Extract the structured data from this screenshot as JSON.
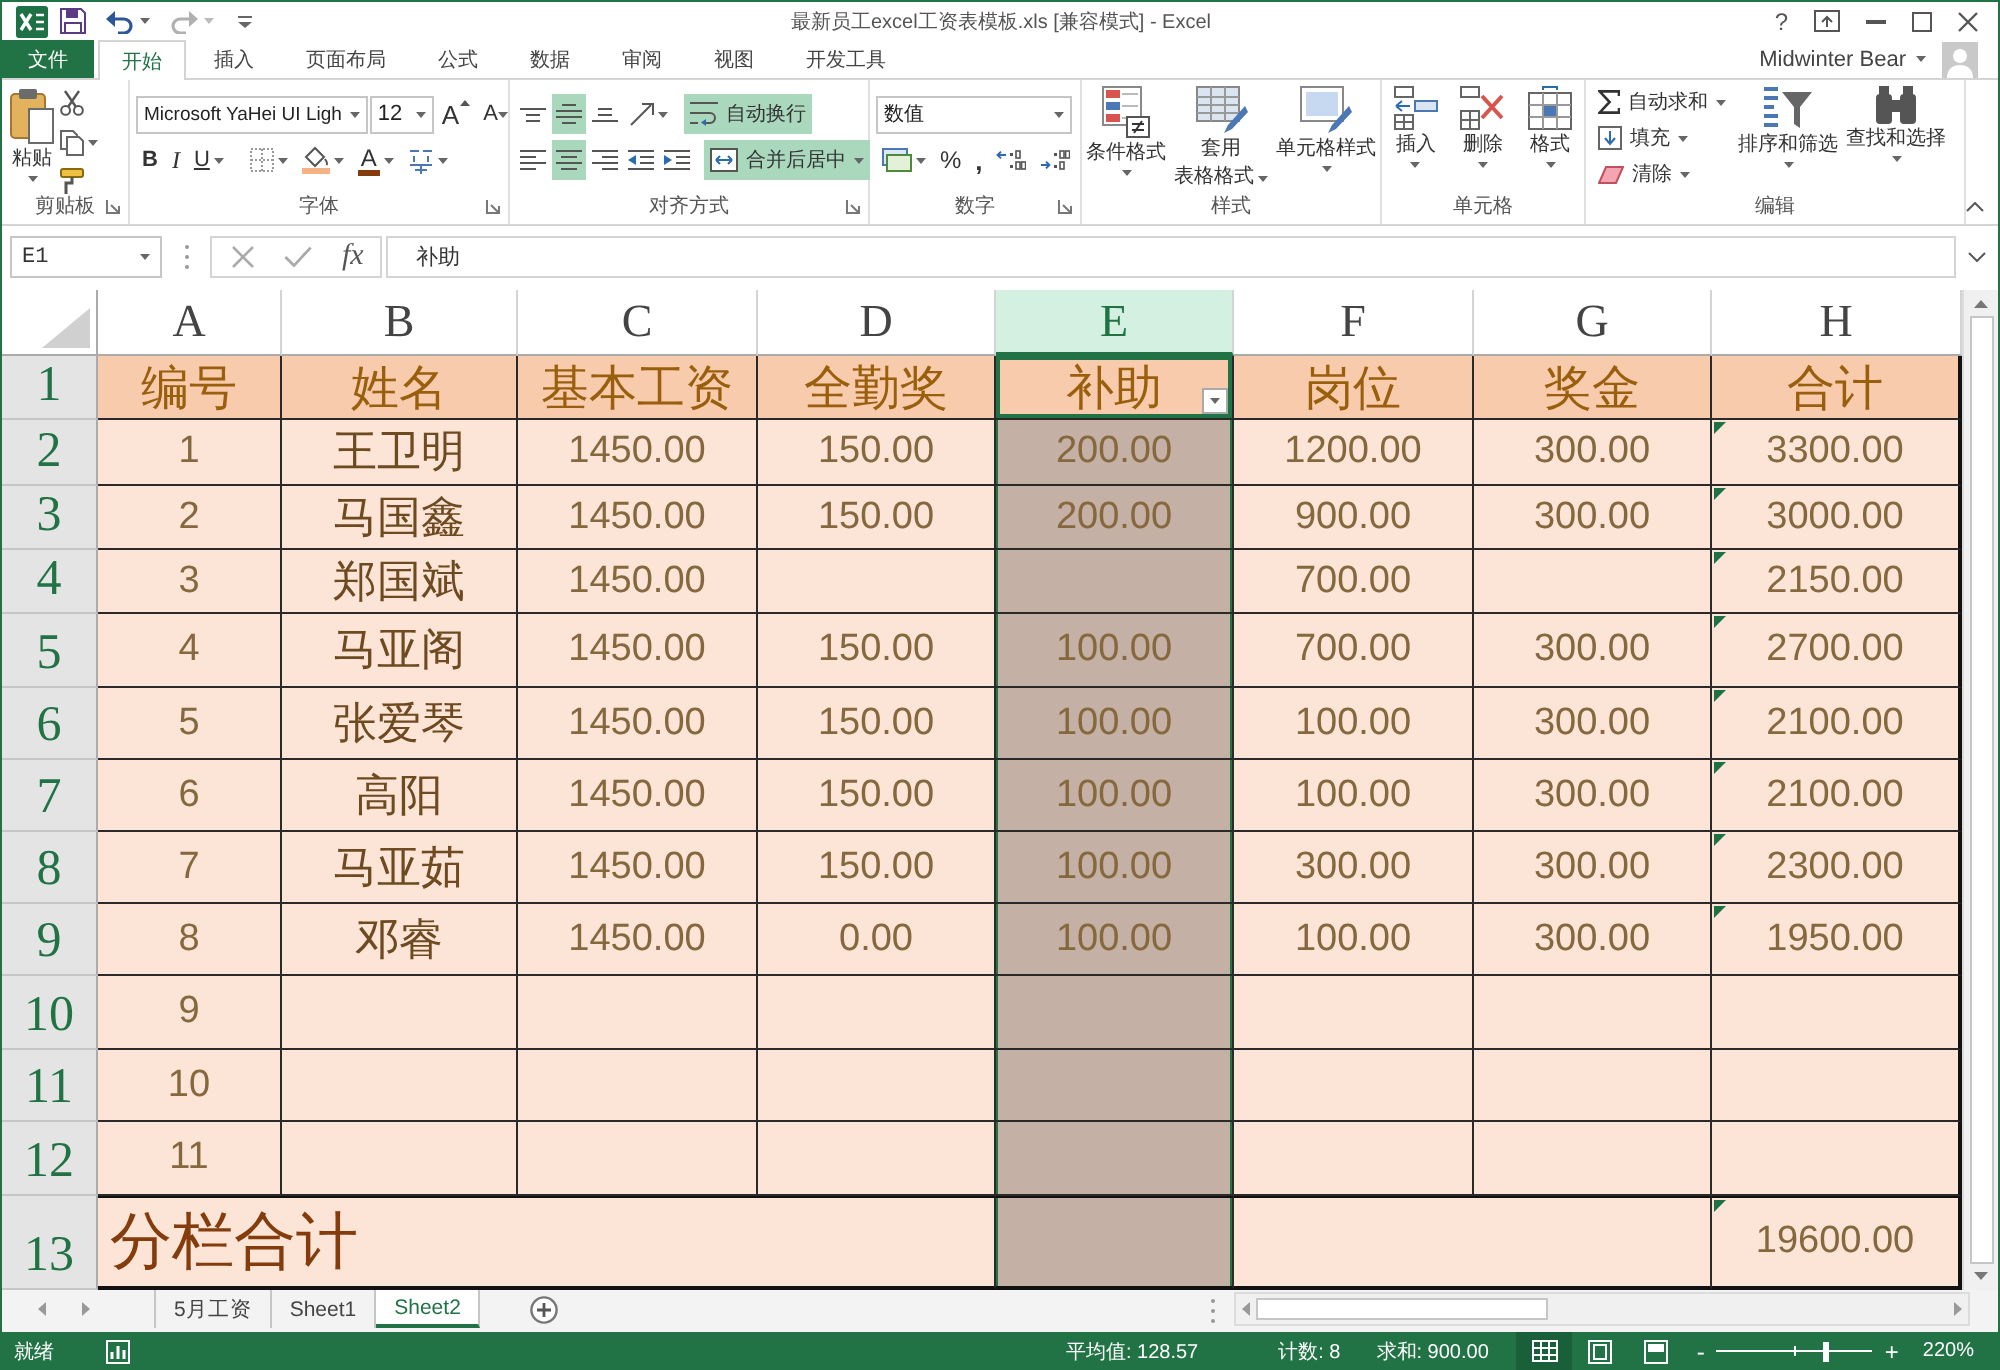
{
  "window": {
    "title": "最新员工excel工资表模板.xls [兼容模式] - Excel",
    "help": "?",
    "user": "Midwinter Bear"
  },
  "ribbon_tabs": [
    {
      "label": "文件",
      "kind": "file",
      "selected": false
    },
    {
      "label": "开始",
      "kind": "tab",
      "selected": true
    },
    {
      "label": "插入",
      "kind": "tab",
      "selected": false
    },
    {
      "label": "页面布局",
      "kind": "tab",
      "selected": false
    },
    {
      "label": "公式",
      "kind": "tab",
      "selected": false
    },
    {
      "label": "数据",
      "kind": "tab",
      "selected": false
    },
    {
      "label": "审阅",
      "kind": "tab",
      "selected": false
    },
    {
      "label": "视图",
      "kind": "tab",
      "selected": false
    },
    {
      "label": "开发工具",
      "kind": "tab",
      "selected": false
    }
  ],
  "ribbon": {
    "groups": [
      {
        "kind": "clipboard",
        "label": "剪贴板",
        "launcher": true,
        "paste": "粘贴"
      },
      {
        "kind": "font",
        "label": "字体",
        "launcher": true,
        "font_name": "Microsoft YaHei UI Ligh",
        "font_size": "12",
        "grow": "A",
        "shrink": "A",
        "bold": "B",
        "italic": "I",
        "underline": "U",
        "font_color": "A"
      },
      {
        "kind": "alignment",
        "label": "对齐方式",
        "launcher": true,
        "vertical_align": [
          {
            "kind": "top",
            "selected": false
          },
          {
            "kind": "middle",
            "selected": true
          },
          {
            "kind": "bottom",
            "selected": false
          }
        ],
        "horizontal_align": [
          {
            "kind": "left",
            "selected": false
          },
          {
            "kind": "center",
            "selected": true
          },
          {
            "kind": "right",
            "selected": false
          }
        ],
        "wrap_text": {
          "label": "自动换行",
          "on": true
        },
        "merge": {
          "label": "合并后居中",
          "on": true
        }
      },
      {
        "kind": "number",
        "label": "数字",
        "launcher": true,
        "format": "数值",
        "percent": "%",
        "comma": ","
      },
      {
        "kind": "styles",
        "label": "样式",
        "launcher": false,
        "buttons": [
          {
            "kind": "conditional",
            "lines": [
              "条件格式"
            ]
          },
          {
            "kind": "table",
            "lines": [
              "套用",
              "表格格式"
            ]
          },
          {
            "kind": "cell_styles",
            "lines": [
              "单元格样式"
            ]
          }
        ]
      },
      {
        "kind": "cells",
        "label": "单元格",
        "launcher": false,
        "buttons": [
          {
            "kind": "insert",
            "lines": [
              "插入"
            ]
          },
          {
            "kind": "delete",
            "lines": [
              "删除"
            ]
          },
          {
            "kind": "format",
            "lines": [
              "格式"
            ]
          }
        ]
      },
      {
        "kind": "editing",
        "label": "编辑",
        "launcher": false,
        "small_buttons": [
          {
            "kind": "autosum",
            "label": "自动求和"
          },
          {
            "kind": "fill",
            "label": "填充"
          },
          {
            "kind": "clear",
            "label": "清除"
          }
        ],
        "buttons": [
          {
            "kind": "sort",
            "lines": [
              "排序和筛选"
            ]
          },
          {
            "kind": "find",
            "lines": [
              "查找和选择"
            ]
          }
        ]
      }
    ]
  },
  "formula_bar": {
    "name_box": "E1",
    "function_label": "fx",
    "content": "补助"
  },
  "sheet": {
    "columns": [
      {
        "label": "A",
        "selected": false
      },
      {
        "label": "B",
        "selected": false
      },
      {
        "label": "C",
        "selected": false
      },
      {
        "label": "D",
        "selected": false
      },
      {
        "label": "E",
        "selected": true
      },
      {
        "label": "F",
        "selected": false
      },
      {
        "label": "G",
        "selected": false
      },
      {
        "label": "H",
        "selected": false
      }
    ],
    "rows": [
      {
        "number": "1",
        "kind": "header",
        "selected": true,
        "flagged": false,
        "cells": [
          {
            "text": "编号",
            "active": false,
            "filter_button": false
          },
          {
            "text": "姓名",
            "active": false,
            "filter_button": false
          },
          {
            "text": "基本工资",
            "active": false,
            "filter_button": false
          },
          {
            "text": "全勤奖",
            "active": false,
            "filter_button": false
          },
          {
            "text": "补助",
            "active": true,
            "filter_button": true
          },
          {
            "text": "岗位",
            "active": false,
            "filter_button": false
          },
          {
            "text": "奖金",
            "active": false,
            "filter_button": false
          },
          {
            "text": "合计",
            "active": false,
            "filter_button": false
          }
        ]
      },
      {
        "number": "2",
        "kind": "data",
        "selected": true,
        "flagged": true,
        "cells": [
          "1",
          "王卫明",
          "1450.00",
          "150.00",
          "200.00",
          "1200.00",
          "300.00",
          "3300.00"
        ]
      },
      {
        "number": "3",
        "kind": "data",
        "selected": true,
        "flagged": true,
        "cells": [
          "2",
          "马国鑫",
          "1450.00",
          "150.00",
          "200.00",
          "900.00",
          "300.00",
          "3000.00"
        ]
      },
      {
        "number": "4",
        "kind": "data",
        "selected": true,
        "flagged": true,
        "cells": [
          "3",
          "郑国斌",
          "1450.00",
          null,
          null,
          "700.00",
          null,
          "2150.00"
        ]
      },
      {
        "number": "5",
        "kind": "data",
        "selected": true,
        "flagged": true,
        "cells": [
          "4",
          "马亚阁",
          "1450.00",
          "150.00",
          "100.00",
          "700.00",
          "300.00",
          "2700.00"
        ]
      },
      {
        "number": "6",
        "kind": "data",
        "selected": true,
        "flagged": true,
        "cells": [
          "5",
          "张爱琴",
          "1450.00",
          "150.00",
          "100.00",
          "100.00",
          "300.00",
          "2100.00"
        ]
      },
      {
        "number": "7",
        "kind": "data",
        "selected": true,
        "flagged": true,
        "cells": [
          "6",
          "高阳",
          "1450.00",
          "150.00",
          "100.00",
          "100.00",
          "300.00",
          "2100.00"
        ]
      },
      {
        "number": "8",
        "kind": "data",
        "selected": true,
        "flagged": true,
        "cells": [
          "7",
          "马亚茹",
          "1450.00",
          "150.00",
          "100.00",
          "300.00",
          "300.00",
          "2300.00"
        ]
      },
      {
        "number": "9",
        "kind": "data",
        "selected": true,
        "flagged": true,
        "cells": [
          "8",
          "邓睿",
          "1450.00",
          "0.00",
          "100.00",
          "100.00",
          "300.00",
          "1950.00"
        ]
      },
      {
        "number": "10",
        "kind": "data",
        "selected": true,
        "flagged": false,
        "cells": [
          "9",
          null,
          null,
          null,
          null,
          null,
          null,
          null
        ]
      },
      {
        "number": "11",
        "kind": "data",
        "selected": true,
        "flagged": false,
        "cells": [
          "10",
          null,
          null,
          null,
          null,
          null,
          null,
          null
        ]
      },
      {
        "number": "12",
        "kind": "data",
        "selected": true,
        "flagged": false,
        "cells": [
          "11",
          null,
          null,
          null,
          null,
          null,
          null,
          null
        ]
      },
      {
        "number": "13",
        "kind": "total",
        "selected": true,
        "flagged": true,
        "label": "分栏合计",
        "total": "19600.00"
      }
    ]
  },
  "sheet_tabs": [
    {
      "label": "5月工资",
      "selected": false
    },
    {
      "label": "Sheet1",
      "selected": false
    },
    {
      "label": "Sheet2",
      "selected": true
    }
  ],
  "status_bar": {
    "mode": "就绪",
    "average": "平均值: 128.57",
    "count": "计数: 8",
    "sum": "求和: 900.00",
    "views": [
      {
        "kind": "normal",
        "selected": true
      },
      {
        "kind": "page_layout",
        "selected": false
      },
      {
        "kind": "page_break",
        "selected": false
      }
    ],
    "zoom": {
      "zoom_out": "-",
      "zoom_in": "+",
      "level": 0.7,
      "reading": "220%"
    }
  }
}
